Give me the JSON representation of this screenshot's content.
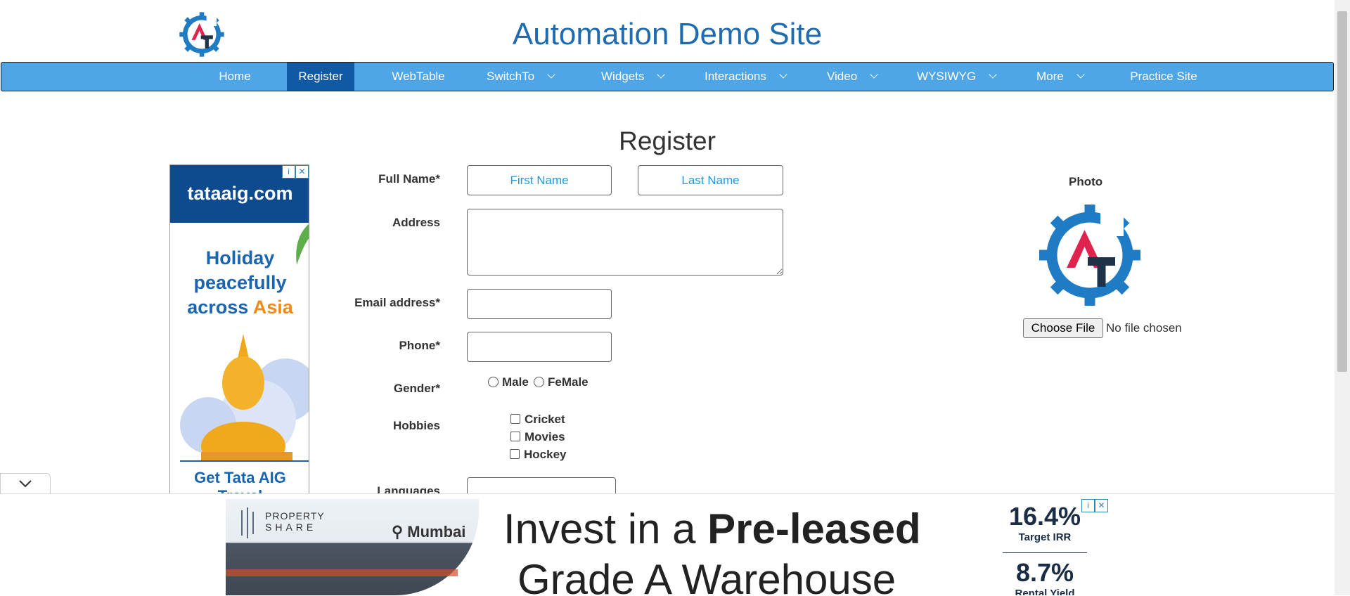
{
  "header": {
    "title": "Automation Demo Site"
  },
  "nav": {
    "items": [
      {
        "label": "Home"
      },
      {
        "label": "Register"
      },
      {
        "label": "WebTable"
      },
      {
        "label": "SwitchTo"
      },
      {
        "label": "Widgets"
      },
      {
        "label": "Interactions"
      },
      {
        "label": "Video"
      },
      {
        "label": "WYSIWYG"
      },
      {
        "label": "More"
      },
      {
        "label": "Practice Site"
      }
    ],
    "active": "Register",
    "colors": {
      "bar": "#4ea6e6",
      "active": "#0f5aa3"
    }
  },
  "form": {
    "title": "Register",
    "full_name_label": "Full Name*",
    "first_name_placeholder": "First Name",
    "last_name_placeholder": "Last Name",
    "address_label": "Address",
    "email_label": "Email address*",
    "phone_label": "Phone*",
    "gender_label": "Gender*",
    "gender_options": [
      "Male",
      "FeMale"
    ],
    "hobbies_label": "Hobbies",
    "hobbies": [
      "Cricket",
      "Movies",
      "Hockey"
    ],
    "languages_label": "Languages"
  },
  "photo": {
    "label": "Photo",
    "button": "Choose File",
    "status": "No file chosen"
  },
  "left_ad": {
    "brand": "tataaig.com",
    "line1": "Holiday",
    "line2": "peacefully",
    "line3a": "across ",
    "line3b": "Asia",
    "cta": "Get Tata AIG Travel"
  },
  "bottom_ad": {
    "brand_line1": "PROPERTY",
    "brand_line2": "SHARE",
    "location": "Mumbai",
    "headline_a": "Invest in a ",
    "headline_b": "Pre-leased",
    "headline2": "Grade A Warehouse",
    "stat1_value": "16.4%",
    "stat1_label": "Target IRR",
    "stat2_value": "8.7%",
    "stat2_label": "Rental Yield"
  }
}
